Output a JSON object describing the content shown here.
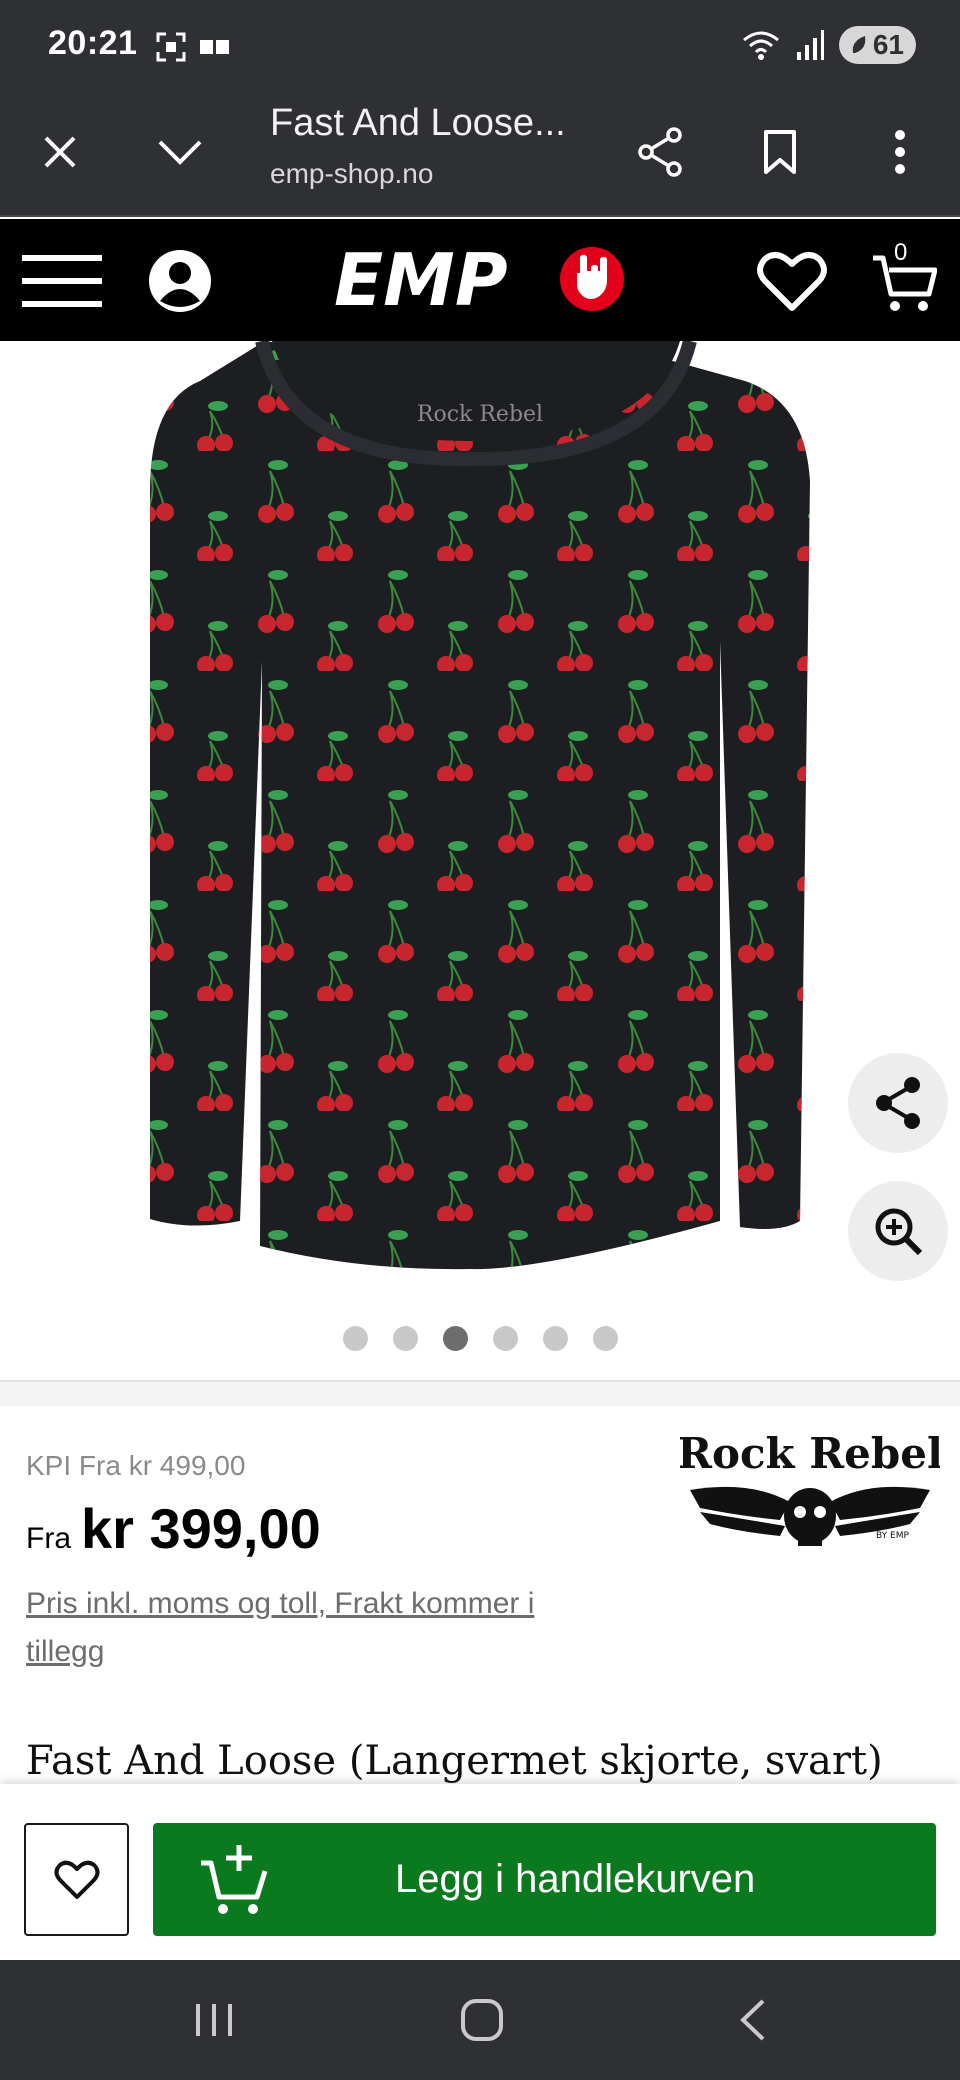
{
  "status": {
    "time": "20:21",
    "battery": "61"
  },
  "browser": {
    "title": "Fast And Loose...",
    "url": "emp-shop.no"
  },
  "header": {
    "logo_text": "EMP",
    "cart_count": "0"
  },
  "gallery": {
    "total": 6,
    "active_index": 2,
    "shirt_logo": "Rock Rebel"
  },
  "product": {
    "kpi": "KPI Fra kr 499,00",
    "price_prefix": "Fra",
    "price": "kr 399,00",
    "price_info": "Pris inkl. moms og toll, Frakt kommer i tillegg",
    "brand": "Rock Rebel",
    "brand_sub": "BY EMP",
    "title": "Fast And Loose (Langermet skjorte, svart)"
  },
  "actions": {
    "add_to_cart": "Legg i handlekurven"
  },
  "colors": {
    "bars": "#2f3033",
    "header": "#000000",
    "accent_red": "#e2001a",
    "cta_green": "#0b7a1e"
  }
}
